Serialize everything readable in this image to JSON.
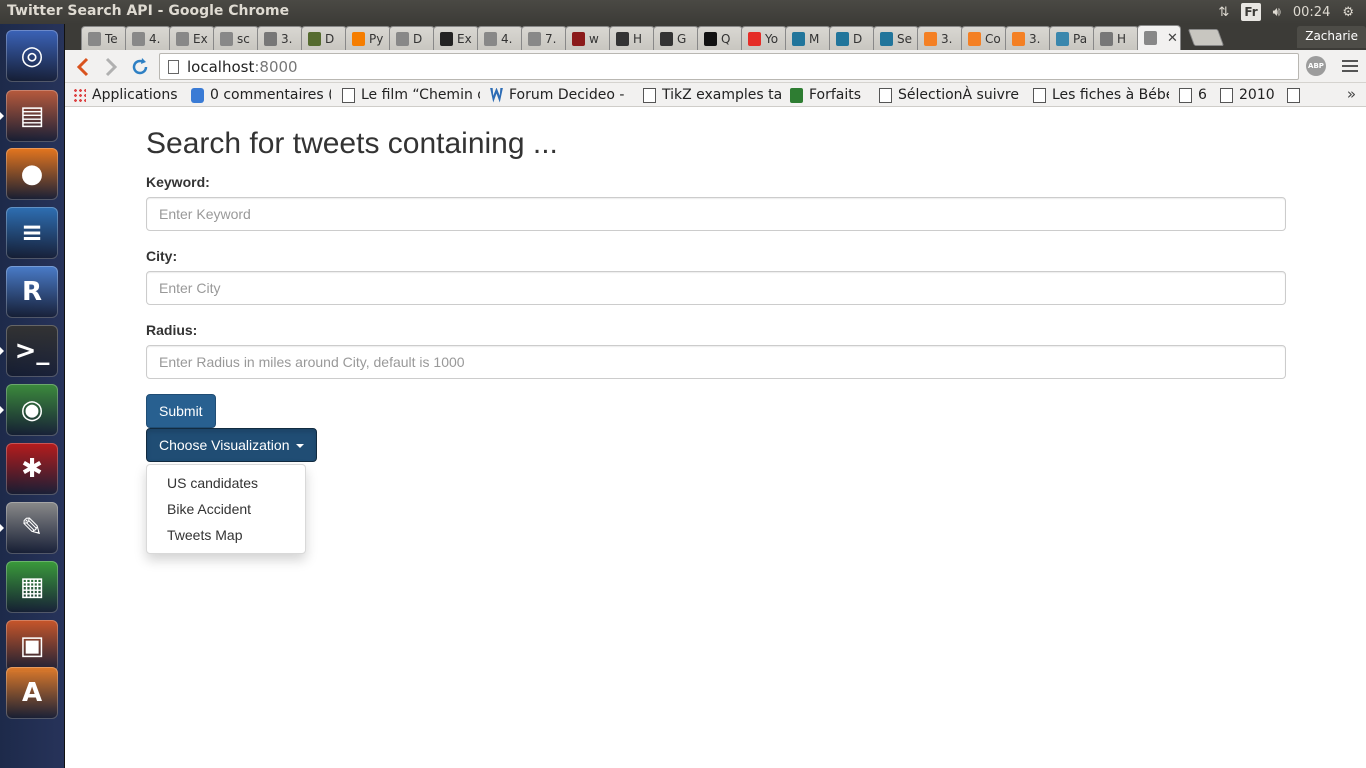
{
  "system_panel": {
    "window_title": "Twitter Search API - Google Chrome",
    "keyboard_layout": "Fr",
    "clock": "00:24"
  },
  "launcher": {
    "items": [
      {
        "name": "ubuntu-dash",
        "glyph": "◎",
        "color": "#3b63b8"
      },
      {
        "name": "files",
        "glyph": "▤",
        "color": "#b85a3c"
      },
      {
        "name": "firefox",
        "glyph": "●",
        "color": "#e5761e"
      },
      {
        "name": "libreoffice-writer",
        "glyph": "≡",
        "color": "#2e6fb3"
      },
      {
        "name": "rstudio",
        "glyph": "R",
        "color": "#4a7cc9"
      },
      {
        "name": "terminal",
        "glyph": ">_",
        "color": "#333333"
      },
      {
        "name": "chrome",
        "glyph": "◉",
        "color": "#3c8b3c"
      },
      {
        "name": "network-tool",
        "glyph": "✱",
        "color": "#b71c1c"
      },
      {
        "name": "text-editor",
        "glyph": "✎",
        "color": "#8a8a8a"
      },
      {
        "name": "libreoffice-calc",
        "glyph": "▦",
        "color": "#3a9b3a"
      },
      {
        "name": "libreoffice-impress",
        "glyph": "▣",
        "color": "#c8562a"
      },
      {
        "name": "software-center",
        "glyph": "A",
        "color": "#e07b2a"
      }
    ]
  },
  "tabs": [
    {
      "label": "Te",
      "fav": "#888888"
    },
    {
      "label": "4.",
      "fav": "#888888"
    },
    {
      "label": "Ex",
      "fav": "#888888"
    },
    {
      "label": "sc",
      "fav": "#888888"
    },
    {
      "label": "3.",
      "fav": "#777777"
    },
    {
      "label": "D",
      "fav": "#556b2f"
    },
    {
      "label": "Py",
      "fav": "#f57d00"
    },
    {
      "label": "D",
      "fav": "#888888"
    },
    {
      "label": "Ex",
      "fav": "#222222"
    },
    {
      "label": "4.",
      "fav": "#888888"
    },
    {
      "label": "7.",
      "fav": "#888888"
    },
    {
      "label": "w",
      "fav": "#8b1a1a"
    },
    {
      "label": "H",
      "fav": "#333333"
    },
    {
      "label": "G",
      "fav": "#333333"
    },
    {
      "label": "Q",
      "fav": "#111111"
    },
    {
      "label": "Yo",
      "fav": "#e52d27"
    },
    {
      "label": "M",
      "fav": "#21759b"
    },
    {
      "label": "D",
      "fav": "#21759b"
    },
    {
      "label": "Se",
      "fav": "#21759b"
    },
    {
      "label": "3.",
      "fav": "#f48024"
    },
    {
      "label": "Co",
      "fav": "#f48024"
    },
    {
      "label": "3.",
      "fav": "#f48024"
    },
    {
      "label": "Pa",
      "fav": "#3a87ad"
    },
    {
      "label": "H",
      "fav": "#777777"
    },
    {
      "label": "",
      "fav": "#888888"
    }
  ],
  "profile_name": "Zacharie",
  "omnibox": {
    "host": "localhost",
    "port": ":8000"
  },
  "abp_label": "ABP",
  "bookmarks": [
    {
      "label": "Applications",
      "icon": "grid"
    },
    {
      "label": "0 commentaires (",
      "icon": "blue"
    },
    {
      "label": "Le film “Chemin d",
      "icon": "page"
    },
    {
      "label": "Forum Decideo - ",
      "icon": "w"
    },
    {
      "label": "TikZ examples tag",
      "icon": "page"
    },
    {
      "label": "Forfaits",
      "icon": "green"
    },
    {
      "label": "SélectionÀ suivre",
      "icon": "page"
    },
    {
      "label": "Les fiches à Bébe",
      "icon": "page"
    },
    {
      "label": "6",
      "icon": "page"
    },
    {
      "label": "2010",
      "icon": "page"
    },
    {
      "label": "",
      "icon": "page"
    }
  ],
  "bookmarks_more": "»",
  "form": {
    "title": "Search for tweets containing ...",
    "keyword_label": "Keyword:",
    "keyword_placeholder": "Enter Keyword",
    "keyword_value": "",
    "city_label": "City:",
    "city_placeholder": "Enter City",
    "city_value": "",
    "radius_label": "Radius:",
    "radius_placeholder": "Enter Radius in miles around City, default is 1000",
    "radius_value": "",
    "submit_label": "Submit",
    "visualization_label": "Choose Visualization",
    "visualization_options": [
      "US candidates",
      "Bike Accident",
      "Tweets Map"
    ]
  },
  "colors": {
    "primary_button": "#286090",
    "primary_button_active": "#204d74",
    "heading": "#333333"
  }
}
